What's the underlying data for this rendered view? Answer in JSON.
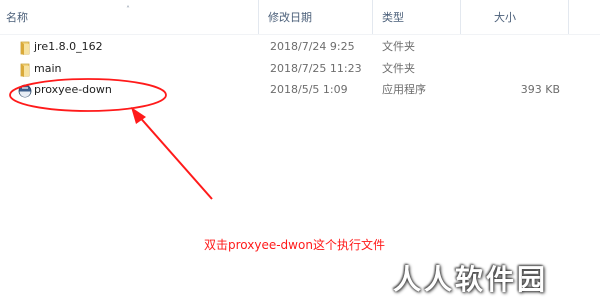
{
  "columns": {
    "name": "名称",
    "date": "修改日期",
    "type": "类型",
    "size": "大小"
  },
  "files": [
    {
      "icon": "folder-icon",
      "name": "jre1.8.0_162",
      "date": "2018/7/24 9:25",
      "type": "文件夹",
      "size": ""
    },
    {
      "icon": "folder-icon",
      "name": "main",
      "date": "2018/7/25 11:23",
      "type": "文件夹",
      "size": ""
    },
    {
      "icon": "application-icon",
      "name": "proxyee-down",
      "date": "2018/5/5 1:09",
      "type": "应用程序",
      "size": "393 KB"
    }
  ],
  "annotation": {
    "text": "双击proxyee-dwon这个执行文件",
    "color": "#ff1a1a"
  },
  "watermark": {
    "text": "人人软件园"
  }
}
